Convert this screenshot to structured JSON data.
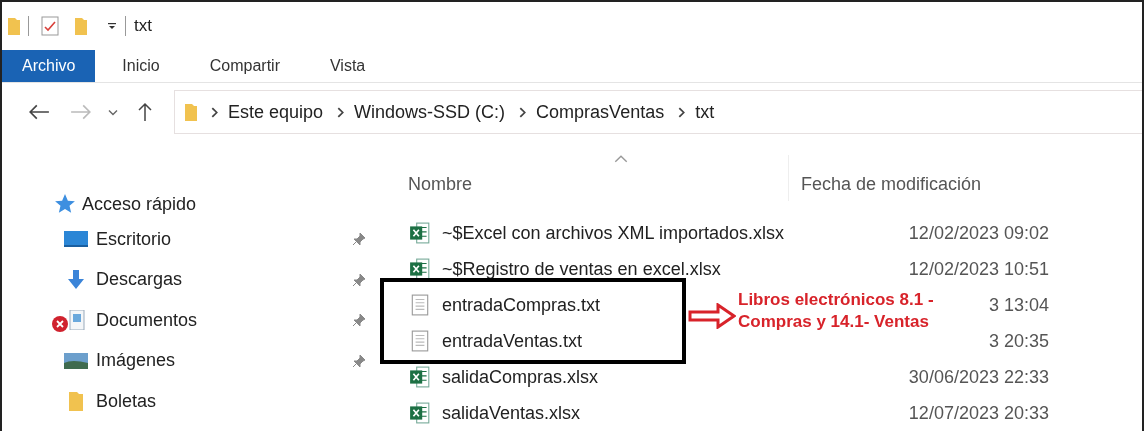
{
  "title_bar": {
    "title": "txt"
  },
  "ribbon_tabs": [
    {
      "label": "Archivo",
      "selected": true
    },
    {
      "label": "Inicio",
      "selected": false
    },
    {
      "label": "Compartir",
      "selected": false
    },
    {
      "label": "Vista",
      "selected": false
    }
  ],
  "address_bar": {
    "crumbs": [
      "Este equipo",
      "Windows-SSD (C:)",
      "ComprasVentas",
      "txt"
    ]
  },
  "sidebar": {
    "header": "Acceso rápido",
    "items": [
      {
        "label": "Escritorio",
        "kind": "desktop",
        "pinned": true,
        "error": false
      },
      {
        "label": "Descargas",
        "kind": "download",
        "pinned": true,
        "error": false
      },
      {
        "label": "Documentos",
        "kind": "documents",
        "pinned": true,
        "error": true
      },
      {
        "label": "Imágenes",
        "kind": "pictures",
        "pinned": true,
        "error": false
      },
      {
        "label": "Boletas",
        "kind": "folder",
        "pinned": false,
        "error": false
      }
    ]
  },
  "file_list": {
    "columns": [
      "Nombre",
      "Fecha de modificación"
    ],
    "rows": [
      {
        "name": "~$Excel con archivos XML importados.xlsx",
        "date": "12/02/2023 09:02",
        "kind": "excel"
      },
      {
        "name": "~$Registro de ventas en excel.xlsx",
        "date": "12/02/2023 10:51",
        "kind": "excel"
      },
      {
        "name": "entradaCompras.txt",
        "date": "3 13:04",
        "kind": "text"
      },
      {
        "name": "entradaVentas.txt",
        "date": "3 20:35",
        "kind": "text"
      },
      {
        "name": "salidaCompras.xlsx",
        "date": "30/06/2023 22:33",
        "kind": "excel"
      },
      {
        "name": "salidaVentas.xlsx",
        "date": "12/07/2023 20:33",
        "kind": "excel"
      }
    ]
  },
  "annotation": {
    "lines": [
      "Libros electrónicos 8.1 -",
      "Compras y 14.1- Ventas"
    ]
  }
}
